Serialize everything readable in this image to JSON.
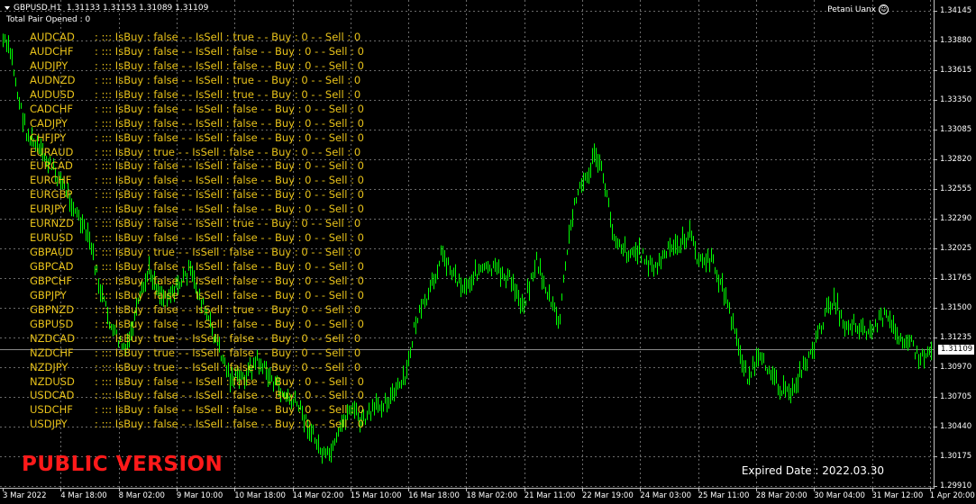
{
  "chart": {
    "symbol": "GBPUSD,H1",
    "ohlc": "1.31133 1.31153 1.31089 1.31109",
    "total_pairs": "Total Pair Opened : 0",
    "ea_name": "Petani Uanx",
    "current_price": "1.31109",
    "public_version": "PUBLIC VERSION",
    "expired_date": "Expired Date : 2022.03.30",
    "bull_color": "#00ff00",
    "grid_color": "#6b6b6b"
  },
  "pairs": [
    {
      "name": "AUDCAD",
      "status": ": ::: IsBuy : false - - IsSell : true - - Buy : 0 - - Sell : 0"
    },
    {
      "name": "AUDCHF",
      "status": ": ::: IsBuy : false - - IsSell : false - - Buy : 0 - - Sell : 0"
    },
    {
      "name": "AUDJPY",
      "status": ": ::: IsBuy : false - - IsSell : false - - Buy : 0 - - Sell : 0"
    },
    {
      "name": "AUDNZD",
      "status": ": ::: IsBuy : false - - IsSell : true - - Buy : 0 - - Sell : 0"
    },
    {
      "name": "AUDUSD",
      "status": ": ::: IsBuy : false - - IsSell : true - - Buy : 0 - - Sell : 0"
    },
    {
      "name": "CADCHF",
      "status": ": ::: IsBuy : false - - IsSell : false - - Buy : 0 - - Sell : 0"
    },
    {
      "name": "CADJPY",
      "status": ": ::: IsBuy : false - - IsSell : false - - Buy : 0 - - Sell : 0"
    },
    {
      "name": "CHFJPY",
      "status": ": ::: IsBuy : false - - IsSell : false - - Buy : 0 - - Sell : 0"
    },
    {
      "name": "EURAUD",
      "status": ": ::: IsBuy : true - - IsSell : false - - Buy : 0 - - Sell : 0"
    },
    {
      "name": "EURCAD",
      "status": ": ::: IsBuy : false - - IsSell : false - - Buy : 0 - - Sell : 0"
    },
    {
      "name": "EURCHF",
      "status": ": ::: IsBuy : false - - IsSell : false - - Buy : 0 - - Sell : 0"
    },
    {
      "name": "EURGBP",
      "status": ": ::: IsBuy : false - - IsSell : false - - Buy : 0 - - Sell : 0"
    },
    {
      "name": "EURJPY",
      "status": ": ::: IsBuy : false - - IsSell : false - - Buy : 0 - - Sell : 0"
    },
    {
      "name": "EURNZD",
      "status": ": ::: IsBuy : false - - IsSell : true - - Buy : 0 - - Sell : 0"
    },
    {
      "name": "EURUSD",
      "status": ": ::: IsBuy : false - - IsSell : false - - Buy : 0 - - Sell : 0"
    },
    {
      "name": "GBPAUD",
      "status": ": ::: IsBuy : true - - IsSell : false - - Buy : 0 - - Sell : 0"
    },
    {
      "name": "GBPCAD",
      "status": ": ::: IsBuy : false - - IsSell : false - - Buy : 0 - - Sell : 0"
    },
    {
      "name": "GBPCHF",
      "status": ": ::: IsBuy : false - - IsSell : false - - Buy : 0 - - Sell : 0"
    },
    {
      "name": "GBPJPY",
      "status": ": ::: IsBuy : false - - IsSell : false - - Buy : 0 - - Sell : 0"
    },
    {
      "name": "GBPNZD",
      "status": ": ::: IsBuy : false - - IsSell : true - - Buy : 0 - - Sell : 0"
    },
    {
      "name": "GBPUSD",
      "status": ": ::: IsBuy : false - - IsSell : false - - Buy : 0 - - Sell : 0"
    },
    {
      "name": "NZDCAD",
      "status": ": ::: IsBuy : true - - IsSell : false - - Buy : 0 - - Sell : 0"
    },
    {
      "name": "NZDCHF",
      "status": ": ::: IsBuy : true - - IsSell : false - - Buy : 0 - - Sell : 0"
    },
    {
      "name": "NZDJPY",
      "status": ": ::: IsBuy : true - - IsSell : false - - Buy : 0 - - Sell : 0"
    },
    {
      "name": "NZDUSD",
      "status": ": ::: IsBuy : false - - IsSell : false - - Buy : 0 - - Sell : 0"
    },
    {
      "name": "USDCAD",
      "status": ": ::: IsBuy : false - - IsSell : false - - Buy : 0 - - Sell : 0"
    },
    {
      "name": "USDCHF",
      "status": ": ::: IsBuy : false - - IsSell : false - - Buy : 0 - - Sell : 0"
    },
    {
      "name": "USDJPY",
      "status": ": ::: IsBuy : false - - IsSell : false - - Buy : 0 - - Sell : 0"
    }
  ],
  "price_labels": [
    "1.34145",
    "1.33880",
    "1.33615",
    "1.33350",
    "1.33085",
    "1.32820",
    "1.32555",
    "1.32290",
    "1.32025",
    "1.31765",
    "1.31500",
    "1.31235",
    "1.30970",
    "1.30705",
    "1.30440",
    "1.30175",
    "1.29910"
  ],
  "time_labels": [
    "3 Mar 2022",
    "4 Mar 18:00",
    "8 Mar 02:00",
    "9 Mar 10:00",
    "10 Mar 18:00",
    "14 Mar 02:00",
    "15 Mar 10:00",
    "16 Mar 18:00",
    "18 Mar 02:00",
    "21 Mar 11:00",
    "22 Mar 19:00",
    "24 Mar 03:00",
    "25 Mar 11:00",
    "28 Mar 20:00",
    "30 Mar 04:00",
    "31 Mar 12:00",
    "1 Apr 20:00"
  ]
}
